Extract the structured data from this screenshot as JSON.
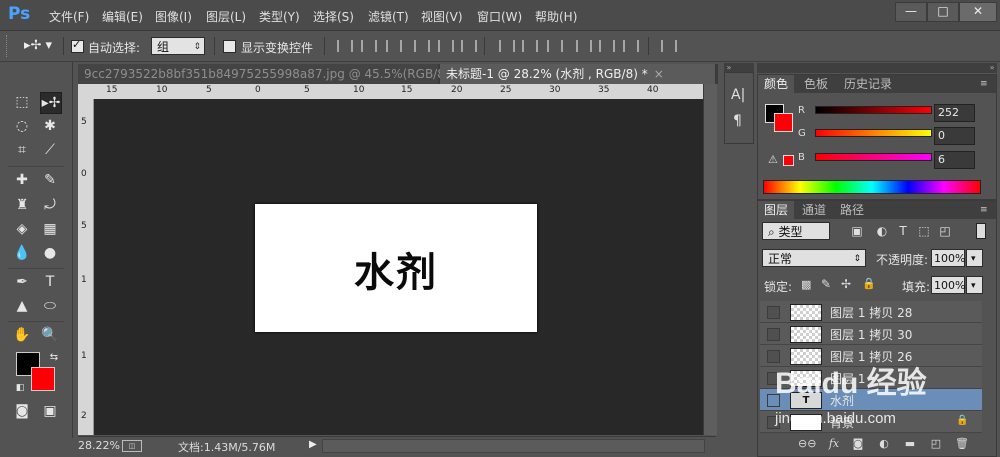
{
  "app": {
    "logo": "Ps"
  },
  "menu": [
    "文件(F)",
    "编辑(E)",
    "图像(I)",
    "图层(L)",
    "类型(Y)",
    "选择(S)",
    "滤镜(T)",
    "视图(V)",
    "窗口(W)",
    "帮助(H)"
  ],
  "window_controls": {
    "minimize": "—",
    "maximize": "□",
    "close": "✕"
  },
  "options": {
    "auto_select_label": "自动选择:",
    "auto_select_checked": true,
    "auto_select_value": "组",
    "show_transform_label": "显示变换控件",
    "show_transform_checked": false
  },
  "tabs": [
    {
      "label": "9cc2793522b8bf351b84975255998a87.jpg @ 45.5%(RGB/8#) *",
      "active": false
    },
    {
      "label": "未标题-1 @ 28.2% (水剂 , RGB/8) *",
      "active": true
    }
  ],
  "ruler": {
    "top": [
      "15",
      "10",
      "5",
      "0",
      "5",
      "10",
      "15",
      "20",
      "25",
      "30",
      "35",
      "40"
    ],
    "left": [
      "5",
      "0",
      "5",
      "1",
      "1",
      "2"
    ]
  },
  "canvas": {
    "text": "水剂"
  },
  "status": {
    "zoom": "28.22%",
    "doc_label": "文档:1.43M/5.76M"
  },
  "color_panel": {
    "tabs": [
      "颜色",
      "色板",
      "历史记录"
    ],
    "active_tab": 0,
    "fg_color": "#000000",
    "bg_color": "#fc0006",
    "channels": [
      {
        "label": "R",
        "value": "252"
      },
      {
        "label": "G",
        "value": "0"
      },
      {
        "label": "B",
        "value": "6"
      }
    ]
  },
  "layers_panel": {
    "tabs": [
      "图层",
      "通道",
      "路径"
    ],
    "active_tab": 0,
    "filter_type": "类型",
    "blend_mode": "正常",
    "opacity_label": "不透明度:",
    "opacity_value": "100%",
    "lock_label": "锁定:",
    "fill_label": "填充:",
    "fill_value": "100%",
    "layers": [
      {
        "name": "图层 1 拷贝 28",
        "selected": false
      },
      {
        "name": "图层 1 拷贝 30",
        "selected": false
      },
      {
        "name": "图层 1 拷贝 26",
        "selected": false
      },
      {
        "name": "图层 1",
        "selected": false
      },
      {
        "name": "水剂",
        "selected": true
      },
      {
        "name": "背景",
        "selected": false
      }
    ]
  },
  "watermark": {
    "brand": "Baidu 经验",
    "url": "jingyan.baidu.com"
  }
}
